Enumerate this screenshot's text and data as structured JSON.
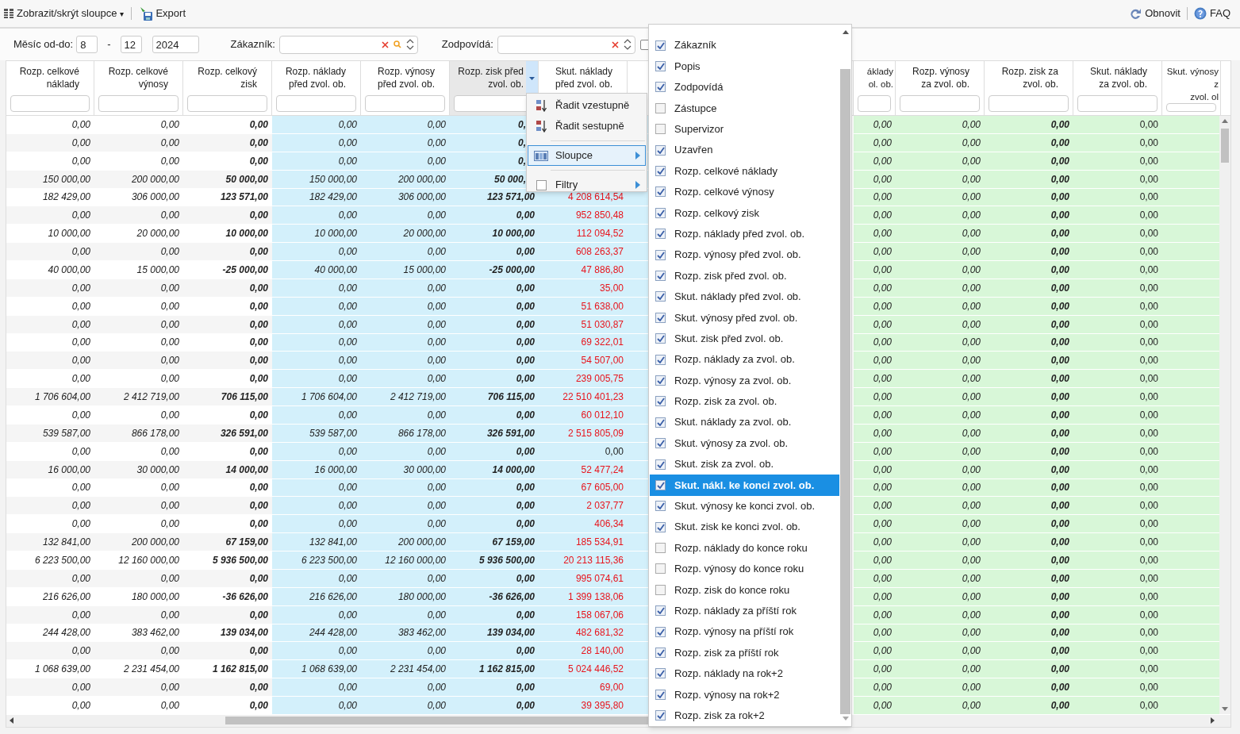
{
  "toolbar": {
    "left": [
      {
        "kind": "columns",
        "label": "Zobrazit/skrýt sloupce",
        "caret": "▾"
      },
      {
        "kind": "export",
        "label": "Export"
      }
    ],
    "right": [
      {
        "kind": "refresh",
        "label": "Obnovit"
      },
      {
        "kind": "help",
        "label": "FAQ"
      }
    ]
  },
  "filters": {
    "month_label": "Měsíc od-do:",
    "month_from": "8",
    "dash": "-",
    "month_to": "12",
    "year": "2024",
    "customer": {
      "label": "Zákazník:",
      "searchable": true
    },
    "responsible": {
      "label": "Zodpovídá:",
      "searchable": false
    },
    "checkbox": {
      "checked": false
    }
  },
  "columns": [
    {
      "header": "Rozp. celkové náklady",
      "color": "#ffffff",
      "kind": "budget",
      "menu_open": false
    },
    {
      "header": "Rozp. celkové výnosy",
      "color": "#ffffff",
      "kind": "budget",
      "menu_open": false
    },
    {
      "header": "Rozp. celkový zisk",
      "color": "#ffffff",
      "kind": "profit",
      "menu_open": false
    },
    {
      "header": "Rozp. náklady před zvol. ob.",
      "color": "#d3f0fb",
      "kind": "budget",
      "menu_open": false
    },
    {
      "header": "Rozp. výnosy před zvol. ob.",
      "color": "#d3f0fb",
      "kind": "budget",
      "menu_open": false
    },
    {
      "header": "Rozp. zisk před zvol. ob.",
      "color": "#d3f0fb",
      "kind": "profit",
      "menu_open": true
    },
    {
      "header": "Skut. náklady před zvol. ob.",
      "color": "#d3f0fb",
      "kind": "variance",
      "menu_open": false
    },
    {
      "header": "áklady\nol. ob.",
      "color": "#d8f7d8",
      "kind": "budget",
      "menu_open": false
    },
    {
      "header": "Rozp. výnosy za zvol. ob.",
      "color": "#d8f7d8",
      "kind": "budget",
      "menu_open": false
    },
    {
      "header": "Rozp. zisk za zvol. ob.",
      "color": "#d8f7d8",
      "kind": "profit",
      "menu_open": false
    },
    {
      "header": "Skut. náklady za zvol. ob.",
      "color": "#d8f7d8",
      "kind": "actual",
      "menu_open": false
    },
    {
      "header": "Skut. výnosy z\nzvol. ol",
      "color": "#d8f7d8",
      "kind": "actual",
      "menu_open": false
    }
  ],
  "rows": [
    {
      "cells": [
        "0,00",
        "0,00",
        "0,00",
        "0,00",
        "0,00",
        "0,",
        null,
        "0,00",
        "0,00",
        "0,00",
        "0,00"
      ]
    },
    {
      "cells": [
        "0,00",
        "0,00",
        "0,00",
        "0,00",
        "0,00",
        "0,",
        null,
        "0,00",
        "0,00",
        "0,00",
        "0,00"
      ]
    },
    {
      "cells": [
        "0,00",
        "0,00",
        "0,00",
        "0,00",
        "0,00",
        "0,",
        null,
        "0,00",
        "0,00",
        "0,00",
        "0,00"
      ]
    },
    {
      "cells": [
        "150 000,00",
        "200 000,00",
        "50 000,00",
        "150 000,00",
        "200 000,00",
        "50 000,",
        null,
        "0,00",
        "0,00",
        "0,00",
        "0,00"
      ]
    },
    {
      "alert": true,
      "cells": [
        "182 429,00",
        "306 000,00",
        "123 571,00",
        "182 429,00",
        "306 000,00",
        "123 571,00",
        "4 208 614,54",
        "0,00",
        "0,00",
        "0,00",
        "0,00"
      ]
    },
    {
      "alert": true,
      "cells": [
        "0,00",
        "0,00",
        "0,00",
        "0,00",
        "0,00",
        "0,00",
        "952 850,48",
        "0,00",
        "0,00",
        "0,00",
        "0,00"
      ]
    },
    {
      "alert": true,
      "cells": [
        "10 000,00",
        "20 000,00",
        "10 000,00",
        "10 000,00",
        "20 000,00",
        "10 000,00",
        "112 094,52",
        "0,00",
        "0,00",
        "0,00",
        "0,00"
      ]
    },
    {
      "alert": true,
      "cells": [
        "0,00",
        "0,00",
        "0,00",
        "0,00",
        "0,00",
        "0,00",
        "608 263,37",
        "0,00",
        "0,00",
        "0,00",
        "0,00"
      ]
    },
    {
      "alert": true,
      "cells": [
        "40 000,00",
        "15 000,00",
        "-25 000,00",
        "40 000,00",
        "15 000,00",
        "-25 000,00",
        "47 886,80",
        "0,00",
        "0,00",
        "0,00",
        "0,00"
      ]
    },
    {
      "alert": true,
      "cells": [
        "0,00",
        "0,00",
        "0,00",
        "0,00",
        "0,00",
        "0,00",
        "35,00",
        "0,00",
        "0,00",
        "0,00",
        "0,00"
      ]
    },
    {
      "alert": true,
      "cells": [
        "0,00",
        "0,00",
        "0,00",
        "0,00",
        "0,00",
        "0,00",
        "51 638,00",
        "0,00",
        "0,00",
        "0,00",
        "0,00"
      ]
    },
    {
      "alert": true,
      "cells": [
        "0,00",
        "0,00",
        "0,00",
        "0,00",
        "0,00",
        "0,00",
        "51 030,87",
        "0,00",
        "0,00",
        "0,00",
        "0,00"
      ]
    },
    {
      "alert": true,
      "cells": [
        "0,00",
        "0,00",
        "0,00",
        "0,00",
        "0,00",
        "0,00",
        "69 322,01",
        "0,00",
        "0,00",
        "0,00",
        "0,00"
      ]
    },
    {
      "alert": true,
      "cells": [
        "0,00",
        "0,00",
        "0,00",
        "0,00",
        "0,00",
        "0,00",
        "54 507,00",
        "0,00",
        "0,00",
        "0,00",
        "0,00"
      ]
    },
    {
      "alert": true,
      "cells": [
        "0,00",
        "0,00",
        "0,00",
        "0,00",
        "0,00",
        "0,00",
        "239 005,75",
        "0,00",
        "0,00",
        "0,00",
        "0,00"
      ]
    },
    {
      "alert": true,
      "cells": [
        "1 706 604,00",
        "2 412 719,00",
        "706 115,00",
        "1 706 604,00",
        "2 412 719,00",
        "706 115,00",
        "22 510 401,23",
        "0,00",
        "0,00",
        "0,00",
        "0,00"
      ]
    },
    {
      "alert": true,
      "cells": [
        "0,00",
        "0,00",
        "0,00",
        "0,00",
        "0,00",
        "0,00",
        "60 012,10",
        "0,00",
        "0,00",
        "0,00",
        "0,00"
      ]
    },
    {
      "alert": true,
      "cells": [
        "539 587,00",
        "866 178,00",
        "326 591,00",
        "539 587,00",
        "866 178,00",
        "326 591,00",
        "2 515 805,09",
        "0,00",
        "0,00",
        "0,00",
        "0,00"
      ]
    },
    {
      "alert": false,
      "cells": [
        "0,00",
        "0,00",
        "0,00",
        "0,00",
        "0,00",
        "0,00",
        "0,00",
        "0,00",
        "0,00",
        "0,00",
        "0,00"
      ]
    },
    {
      "alert": true,
      "cells": [
        "16 000,00",
        "30 000,00",
        "14 000,00",
        "16 000,00",
        "30 000,00",
        "14 000,00",
        "52 477,24",
        "0,00",
        "0,00",
        "0,00",
        "0,00"
      ]
    },
    {
      "alert": true,
      "cells": [
        "0,00",
        "0,00",
        "0,00",
        "0,00",
        "0,00",
        "0,00",
        "67 605,00",
        "0,00",
        "0,00",
        "0,00",
        "0,00"
      ]
    },
    {
      "alert": true,
      "cells": [
        "0,00",
        "0,00",
        "0,00",
        "0,00",
        "0,00",
        "0,00",
        "2 037,77",
        "0,00",
        "0,00",
        "0,00",
        "0,00"
      ]
    },
    {
      "alert": true,
      "cells": [
        "0,00",
        "0,00",
        "0,00",
        "0,00",
        "0,00",
        "0,00",
        "406,34",
        "0,00",
        "0,00",
        "0,00",
        "0,00"
      ]
    },
    {
      "alert": true,
      "cells": [
        "132 841,00",
        "200 000,00",
        "67 159,00",
        "132 841,00",
        "200 000,00",
        "67 159,00",
        "185 534,91",
        "0,00",
        "0,00",
        "0,00",
        "0,00"
      ]
    },
    {
      "alert": true,
      "cells": [
        "6 223 500,00",
        "12 160 000,00",
        "5 936 500,00",
        "6 223 500,00",
        "12 160 000,00",
        "5 936 500,00",
        "20 213 115,36",
        "0,00",
        "0,00",
        "0,00",
        "0,00"
      ]
    },
    {
      "alert": true,
      "cells": [
        "0,00",
        "0,00",
        "0,00",
        "0,00",
        "0,00",
        "0,00",
        "995 074,61",
        "0,00",
        "0,00",
        "0,00",
        "0,00"
      ]
    },
    {
      "alert": true,
      "cells": [
        "216 626,00",
        "180 000,00",
        "-36 626,00",
        "216 626,00",
        "180 000,00",
        "-36 626,00",
        "1 399 138,06",
        "0,00",
        "0,00",
        "0,00",
        "0,00"
      ]
    },
    {
      "alert": true,
      "cells": [
        "0,00",
        "0,00",
        "0,00",
        "0,00",
        "0,00",
        "0,00",
        "158 067,06",
        "0,00",
        "0,00",
        "0,00",
        "0,00"
      ]
    },
    {
      "alert": true,
      "cells": [
        "244 428,00",
        "383 462,00",
        "139 034,00",
        "244 428,00",
        "383 462,00",
        "139 034,00",
        "482 681,32",
        "0,00",
        "0,00",
        "0,00",
        "0,00"
      ]
    },
    {
      "alert": true,
      "cells": [
        "0,00",
        "0,00",
        "0,00",
        "0,00",
        "0,00",
        "0,00",
        "28 140,00",
        "0,00",
        "0,00",
        "0,00",
        "0,00"
      ]
    },
    {
      "alert": true,
      "cells": [
        "1 068 639,00",
        "2 231 454,00",
        "1 162 815,00",
        "1 068 639,00",
        "2 231 454,00",
        "1 162 815,00",
        "5 024 446,52",
        "0,00",
        "0,00",
        "0,00",
        "0,00"
      ]
    },
    {
      "alert": true,
      "cells": [
        "0,00",
        "0,00",
        "0,00",
        "0,00",
        "0,00",
        "0,00",
        "69,00",
        "0,00",
        "0,00",
        "0,00",
        "0,00"
      ]
    },
    {
      "alert": true,
      "cells": [
        "0,00",
        "0,00",
        "0,00",
        "0,00",
        "0,00",
        "0,00",
        "39 395,80",
        "0,00",
        "0,00",
        "0,00",
        "0,00"
      ]
    }
  ],
  "context_menu": {
    "items": [
      {
        "kind": "sort_asc",
        "label": "Řadit vzestupně",
        "selected": false
      },
      {
        "kind": "sort_desc",
        "label": "Řadit sestupně",
        "selected": false
      },
      {
        "kind": "separator"
      },
      {
        "kind": "columns",
        "label": "Sloupce",
        "selected": true
      },
      {
        "kind": "separator"
      },
      {
        "kind": "filters",
        "label": "Filtry",
        "selected": false,
        "checked": false
      }
    ]
  },
  "column_menu": {
    "items": [
      {
        "label": "Zákazník",
        "checked": true,
        "selected": false
      },
      {
        "label": "Popis",
        "checked": true,
        "selected": false
      },
      {
        "label": "Zodpovídá",
        "checked": true,
        "selected": false
      },
      {
        "label": "Zástupce",
        "checked": false,
        "selected": false
      },
      {
        "label": "Supervizor",
        "checked": false,
        "selected": false
      },
      {
        "label": "Uzavřen",
        "checked": true,
        "selected": false
      },
      {
        "label": "Rozp. celkové náklady",
        "checked": true,
        "selected": false
      },
      {
        "label": "Rozp. celkové výnosy",
        "checked": true,
        "selected": false
      },
      {
        "label": "Rozp. celkový zisk",
        "checked": true,
        "selected": false
      },
      {
        "label": "Rozp. náklady před zvol. ob.",
        "checked": true,
        "selected": false
      },
      {
        "label": "Rozp. výnosy před zvol. ob.",
        "checked": true,
        "selected": false
      },
      {
        "label": "Rozp. zisk před zvol. ob.",
        "checked": true,
        "selected": false
      },
      {
        "label": "Skut. náklady před zvol. ob.",
        "checked": true,
        "selected": false
      },
      {
        "label": "Skut. výnosy před zvol. ob.",
        "checked": true,
        "selected": false
      },
      {
        "label": "Skut. zisk před zvol. ob.",
        "checked": true,
        "selected": false
      },
      {
        "label": "Rozp. náklady za zvol. ob.",
        "checked": true,
        "selected": false
      },
      {
        "label": "Rozp. výnosy za zvol. ob.",
        "checked": true,
        "selected": false
      },
      {
        "label": "Rozp. zisk za zvol. ob.",
        "checked": true,
        "selected": false
      },
      {
        "label": "Skut. náklady za zvol. ob.",
        "checked": true,
        "selected": false
      },
      {
        "label": "Skut. výnosy za zvol. ob.",
        "checked": true,
        "selected": false
      },
      {
        "label": "Skut. zisk za zvol. ob.",
        "checked": true,
        "selected": false
      },
      {
        "label": "Skut. nákl. ke konci zvol. ob.",
        "checked": true,
        "selected": true
      },
      {
        "label": "Skut. výnosy ke konci zvol. ob.",
        "checked": true,
        "selected": false
      },
      {
        "label": "Skut. zisk ke konci zvol. ob.",
        "checked": true,
        "selected": false
      },
      {
        "label": "Rozp. náklady do konce roku",
        "checked": false,
        "selected": false
      },
      {
        "label": "Rozp. výnosy do konce roku",
        "checked": false,
        "selected": false
      },
      {
        "label": "Rozp. zisk do konce roku",
        "checked": false,
        "selected": false
      },
      {
        "label": "Rozp. náklady za příští rok",
        "checked": true,
        "selected": false
      },
      {
        "label": "Rozp. výnosy na příští rok",
        "checked": true,
        "selected": false
      },
      {
        "label": "Rozp. zisk za příští rok",
        "checked": true,
        "selected": false
      },
      {
        "label": "Rozp. náklady na rok+2",
        "checked": true,
        "selected": false
      },
      {
        "label": "Rozp. výnosy na rok+2",
        "checked": true,
        "selected": false
      },
      {
        "label": "Rozp. zisk za rok+2",
        "checked": true,
        "selected": false
      }
    ]
  }
}
